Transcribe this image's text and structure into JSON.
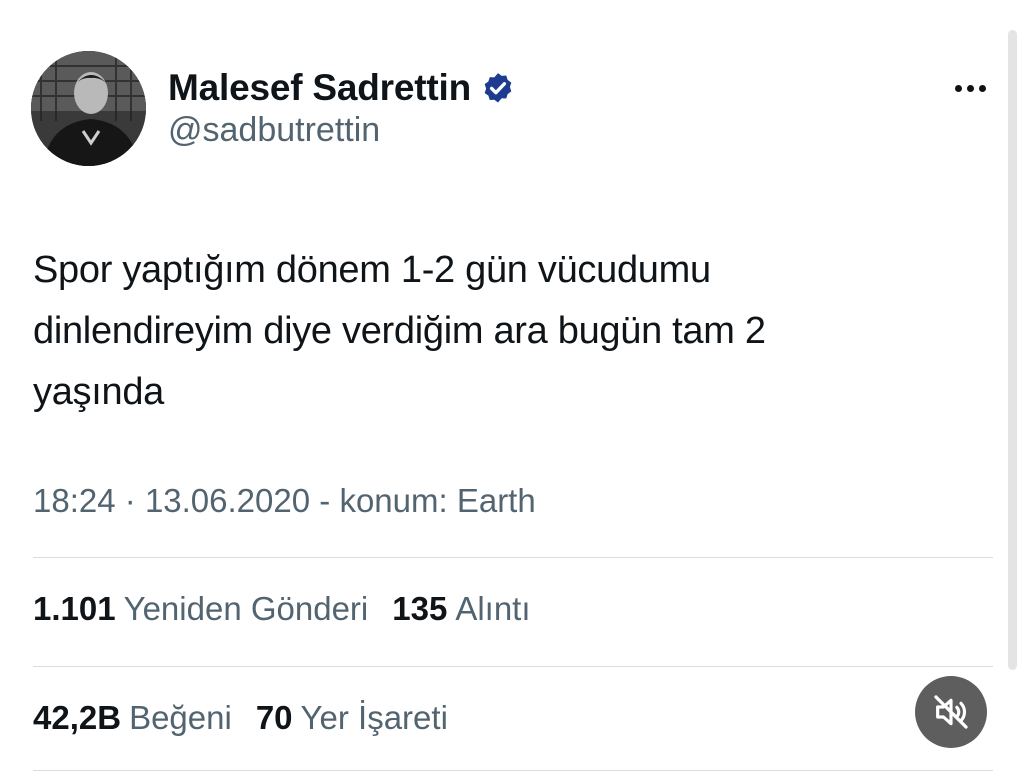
{
  "author": {
    "display_name": "Malesef Sadrettin",
    "handle": "@sadbutrettin",
    "verified_color": "#1d3c8f"
  },
  "tweet": {
    "text_lines": [
      "Spor yaptığım dönem 1-2 gün vücudumu",
      "dinlendireyim diye verdiğim ara bugün tam 2",
      "yaşında"
    ],
    "time": "18:24",
    "separator": "·",
    "date": "13.06.2020",
    "location": "- konum: Earth"
  },
  "stats": {
    "reposts_count": "1.101",
    "reposts_label": "Yeniden Gönderi",
    "quotes_count": "135",
    "quotes_label": "Alıntı",
    "likes_count": "42,2B",
    "likes_label": "Beğeni",
    "bookmarks_count": "70",
    "bookmarks_label": "Yer İşareti"
  },
  "icons": {
    "more": "more-dots-icon",
    "verified": "verified-badge-icon",
    "mute": "speaker-muted-icon"
  }
}
